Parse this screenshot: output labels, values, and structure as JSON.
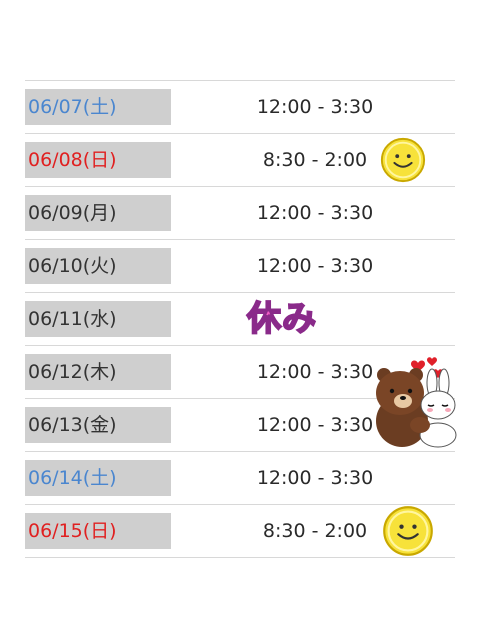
{
  "rows": [
    {
      "date": "06/07(土)",
      "time": "12:00 - 3:30",
      "kind": "sat"
    },
    {
      "date": "06/08(日)",
      "time": "8:30 - 2:00",
      "kind": "sun",
      "sticker": "smiley-icon"
    },
    {
      "date": "06/09(月)",
      "time": "12:00 - 3:30",
      "kind": "weekday"
    },
    {
      "date": "06/10(火)",
      "time": "12:00 - 3:30",
      "kind": "weekday"
    },
    {
      "date": "06/11(水)",
      "time": "休み",
      "kind": "holiday"
    },
    {
      "date": "06/12(木)",
      "time": "12:00 - 3:30",
      "kind": "weekday"
    },
    {
      "date": "06/13(金)",
      "time": "12:00 - 3:30",
      "kind": "weekday"
    },
    {
      "date": "06/14(土)",
      "time": "12:00 - 3:30",
      "kind": "sat"
    },
    {
      "date": "06/15(日)",
      "time": "8:30 - 2:00",
      "kind": "sun",
      "sticker": "smiley-icon"
    }
  ],
  "colors": {
    "saturday": "#4a86cf",
    "sunday": "#e02020",
    "holiday": "#f05cc4",
    "date_bg": "#cfcfcf"
  },
  "decorations": [
    "smiley-icon",
    "bear-bunny-hug-sticker",
    "heart-icon"
  ]
}
